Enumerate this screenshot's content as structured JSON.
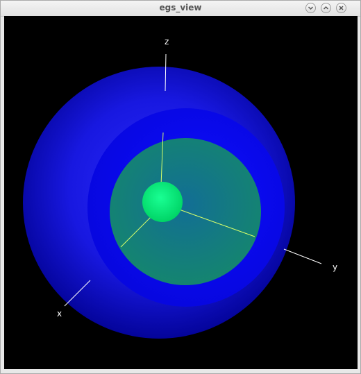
{
  "window": {
    "title": "egs_view",
    "buttons": [
      "minimize",
      "maximize",
      "close"
    ]
  },
  "viewport": {
    "background": "#000000",
    "axes": {
      "x_label": "x",
      "y_label": "y",
      "z_label": "z"
    },
    "objects": [
      {
        "name": "outer-sphere",
        "color": "#1010e8"
      },
      {
        "name": "middle-shell",
        "color": "#0a0af5"
      },
      {
        "name": "inner-sphere",
        "color": "#138a86"
      },
      {
        "name": "core-sphere",
        "color": "#00f07a"
      }
    ]
  }
}
